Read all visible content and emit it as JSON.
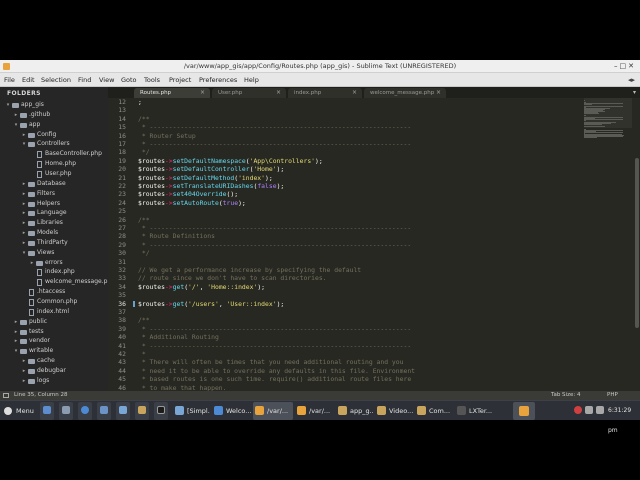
{
  "window": {
    "title": "/var/www/app_gis/app/Config/Routes.php (app_gis) - Sublime Text (UNREGISTERED)"
  },
  "menu": [
    "File",
    "Edit",
    "Selection",
    "Find",
    "View",
    "Goto",
    "Tools",
    "Project",
    "Preferences",
    "Help"
  ],
  "sidebar": {
    "title": "FOLDERS",
    "items": [
      {
        "label": "app_gis",
        "kind": "folder",
        "state": "open",
        "depth": 0
      },
      {
        "label": ".github",
        "kind": "folder",
        "state": "closed",
        "depth": 1
      },
      {
        "label": "app",
        "kind": "folder",
        "state": "open",
        "depth": 1
      },
      {
        "label": "Config",
        "kind": "folder",
        "state": "closed",
        "depth": 2
      },
      {
        "label": "Controllers",
        "kind": "folder",
        "state": "open",
        "depth": 2
      },
      {
        "label": "BaseController.php",
        "kind": "file",
        "depth": 3
      },
      {
        "label": "Home.php",
        "kind": "file",
        "depth": 3
      },
      {
        "label": "User.php",
        "kind": "file",
        "depth": 3
      },
      {
        "label": "Database",
        "kind": "folder",
        "state": "closed",
        "depth": 2
      },
      {
        "label": "Filters",
        "kind": "folder",
        "state": "closed",
        "depth": 2
      },
      {
        "label": "Helpers",
        "kind": "folder",
        "state": "closed",
        "depth": 2
      },
      {
        "label": "Language",
        "kind": "folder",
        "state": "closed",
        "depth": 2
      },
      {
        "label": "Libraries",
        "kind": "folder",
        "state": "closed",
        "depth": 2
      },
      {
        "label": "Models",
        "kind": "folder",
        "state": "closed",
        "depth": 2
      },
      {
        "label": "ThirdParty",
        "kind": "folder",
        "state": "closed",
        "depth": 2
      },
      {
        "label": "Views",
        "kind": "folder",
        "state": "open",
        "depth": 2
      },
      {
        "label": "errors",
        "kind": "folder",
        "state": "closed",
        "depth": 3
      },
      {
        "label": "index.php",
        "kind": "file",
        "depth": 3
      },
      {
        "label": "welcome_message.ph",
        "kind": "file",
        "depth": 3
      },
      {
        "label": ".htaccess",
        "kind": "file",
        "depth": 2
      },
      {
        "label": "Common.php",
        "kind": "file",
        "depth": 2
      },
      {
        "label": "index.html",
        "kind": "file",
        "depth": 2
      },
      {
        "label": "public",
        "kind": "folder",
        "state": "closed",
        "depth": 1
      },
      {
        "label": "tests",
        "kind": "folder",
        "state": "closed",
        "depth": 1
      },
      {
        "label": "vendor",
        "kind": "folder",
        "state": "closed",
        "depth": 1
      },
      {
        "label": "writable",
        "kind": "folder",
        "state": "open",
        "depth": 1
      },
      {
        "label": "cache",
        "kind": "folder",
        "state": "closed",
        "depth": 2
      },
      {
        "label": "debugbar",
        "kind": "folder",
        "state": "closed",
        "depth": 2
      },
      {
        "label": "logs",
        "kind": "folder",
        "state": "closed",
        "depth": 2
      }
    ]
  },
  "tabs": [
    {
      "label": "Routes.php",
      "active": true
    },
    {
      "label": "User.php",
      "active": false
    },
    {
      "label": "index.php",
      "active": false
    },
    {
      "label": "welcome_message.php",
      "active": false
    }
  ],
  "editor": {
    "lines": [
      {
        "n": "12",
        "tokens": [
          [
            "plain",
            ";"
          ]
        ]
      },
      {
        "n": "13",
        "tokens": []
      },
      {
        "n": "14",
        "tokens": [
          [
            "cmt",
            "/**"
          ]
        ]
      },
      {
        "n": "15",
        "tokens": [
          [
            "cmt",
            " * --------------------------------------------------------------------"
          ]
        ]
      },
      {
        "n": "16",
        "tokens": [
          [
            "cmt",
            " * Router Setup"
          ]
        ]
      },
      {
        "n": "17",
        "tokens": [
          [
            "cmt",
            " * --------------------------------------------------------------------"
          ]
        ]
      },
      {
        "n": "18",
        "tokens": [
          [
            "cmt",
            " */"
          ]
        ]
      },
      {
        "n": "19",
        "tokens": [
          [
            "var",
            "$routes"
          ],
          [
            "op",
            "->"
          ],
          [
            "fn",
            "setDefaultNamespace"
          ],
          [
            "plain",
            "("
          ],
          [
            "str",
            "'App\\Controllers'"
          ],
          [
            "plain",
            ");"
          ]
        ]
      },
      {
        "n": "20",
        "tokens": [
          [
            "var",
            "$routes"
          ],
          [
            "op",
            "->"
          ],
          [
            "fn",
            "setDefaultController"
          ],
          [
            "plain",
            "("
          ],
          [
            "str",
            "'Home'"
          ],
          [
            "plain",
            ");"
          ]
        ]
      },
      {
        "n": "21",
        "tokens": [
          [
            "var",
            "$routes"
          ],
          [
            "op",
            "->"
          ],
          [
            "fn",
            "setDefaultMethod"
          ],
          [
            "plain",
            "("
          ],
          [
            "str",
            "'index'"
          ],
          [
            "plain",
            ");"
          ]
        ]
      },
      {
        "n": "22",
        "tokens": [
          [
            "var",
            "$routes"
          ],
          [
            "op",
            "->"
          ],
          [
            "fn",
            "setTranslateURIDashes"
          ],
          [
            "plain",
            "("
          ],
          [
            "const",
            "false"
          ],
          [
            "plain",
            ");"
          ]
        ]
      },
      {
        "n": "23",
        "tokens": [
          [
            "var",
            "$routes"
          ],
          [
            "op",
            "->"
          ],
          [
            "fn",
            "set404Override"
          ],
          [
            "plain",
            "();"
          ]
        ]
      },
      {
        "n": "24",
        "tokens": [
          [
            "var",
            "$routes"
          ],
          [
            "op",
            "->"
          ],
          [
            "fn",
            "setAutoRoute"
          ],
          [
            "plain",
            "("
          ],
          [
            "const",
            "true"
          ],
          [
            "plain",
            ");"
          ]
        ]
      },
      {
        "n": "25",
        "tokens": []
      },
      {
        "n": "26",
        "tokens": [
          [
            "cmt",
            "/**"
          ]
        ]
      },
      {
        "n": "27",
        "tokens": [
          [
            "cmt",
            " * --------------------------------------------------------------------"
          ]
        ]
      },
      {
        "n": "28",
        "tokens": [
          [
            "cmt",
            " * Route Definitions"
          ]
        ]
      },
      {
        "n": "29",
        "tokens": [
          [
            "cmt",
            " * --------------------------------------------------------------------"
          ]
        ]
      },
      {
        "n": "30",
        "tokens": [
          [
            "cmt",
            " */"
          ]
        ]
      },
      {
        "n": "31",
        "tokens": []
      },
      {
        "n": "32",
        "tokens": [
          [
            "cmt",
            "// We get a performance increase by specifying the default"
          ]
        ]
      },
      {
        "n": "33",
        "tokens": [
          [
            "cmt",
            "// route since we don't have to scan directories."
          ]
        ]
      },
      {
        "n": "34",
        "tokens": [
          [
            "var",
            "$routes"
          ],
          [
            "op",
            "->"
          ],
          [
            "fn",
            "get"
          ],
          [
            "plain",
            "("
          ],
          [
            "str",
            "'/'"
          ],
          [
            "plain",
            ", "
          ],
          [
            "str",
            "'Home::index'"
          ],
          [
            "plain",
            ");"
          ]
        ]
      },
      {
        "n": "35",
        "tokens": []
      },
      {
        "n": "36",
        "tokens": [
          [
            "var",
            "$routes"
          ],
          [
            "op",
            "->"
          ],
          [
            "fn",
            "get"
          ],
          [
            "plain",
            "("
          ],
          [
            "str",
            "'/users'"
          ],
          [
            "plain",
            ", "
          ],
          [
            "str",
            "'User::index'"
          ],
          [
            "plain",
            ");"
          ]
        ],
        "current": true
      },
      {
        "n": "37",
        "tokens": []
      },
      {
        "n": "38",
        "tokens": [
          [
            "cmt",
            "/**"
          ]
        ]
      },
      {
        "n": "39",
        "tokens": [
          [
            "cmt",
            " * --------------------------------------------------------------------"
          ]
        ]
      },
      {
        "n": "40",
        "tokens": [
          [
            "cmt",
            " * Additional Routing"
          ]
        ]
      },
      {
        "n": "41",
        "tokens": [
          [
            "cmt",
            " * --------------------------------------------------------------------"
          ]
        ]
      },
      {
        "n": "42",
        "tokens": [
          [
            "cmt",
            " *"
          ]
        ]
      },
      {
        "n": "43",
        "tokens": [
          [
            "cmt",
            " * There will often be times that you need additional routing and you"
          ]
        ]
      },
      {
        "n": "44",
        "tokens": [
          [
            "cmt",
            " * need it to be able to override any defaults in this file. Environment"
          ]
        ]
      },
      {
        "n": "45",
        "tokens": [
          [
            "cmt",
            " * based routes is one such time. require() additional route files here"
          ]
        ]
      },
      {
        "n": "46",
        "tokens": [
          [
            "cmt",
            " * to make that happen."
          ]
        ]
      }
    ]
  },
  "status": {
    "position": "Line 35, Column 28",
    "tab_size": "Tab Size: 4",
    "syntax": "PHP"
  },
  "taskbar": {
    "menu_label": "Menu",
    "windows": [
      {
        "label": "[Simpl...",
        "icon_color": "#7aa6d6"
      },
      {
        "label": "Welco...",
        "icon_color": "#4c8ad6"
      },
      {
        "label": "/var/...",
        "icon_color": "#e8a33d",
        "active": true
      },
      {
        "label": "/var/...",
        "icon_color": "#e8a33d"
      },
      {
        "label": "app_g...",
        "icon_color": "#c9a45c"
      },
      {
        "label": "Video...",
        "icon_color": "#c9a45c"
      },
      {
        "label": "Com...",
        "icon_color": "#c9a45c"
      },
      {
        "label": "LXTer...",
        "icon_color": "#555555"
      }
    ],
    "clock": "6:31:29 pm"
  },
  "colors": {
    "editor_bg": "#272822",
    "sidebar_bg": "#262626",
    "keyword": "#f92672",
    "function": "#66d9ef",
    "string": "#e6db74",
    "comment": "#75715e",
    "constant": "#ae81ff"
  }
}
